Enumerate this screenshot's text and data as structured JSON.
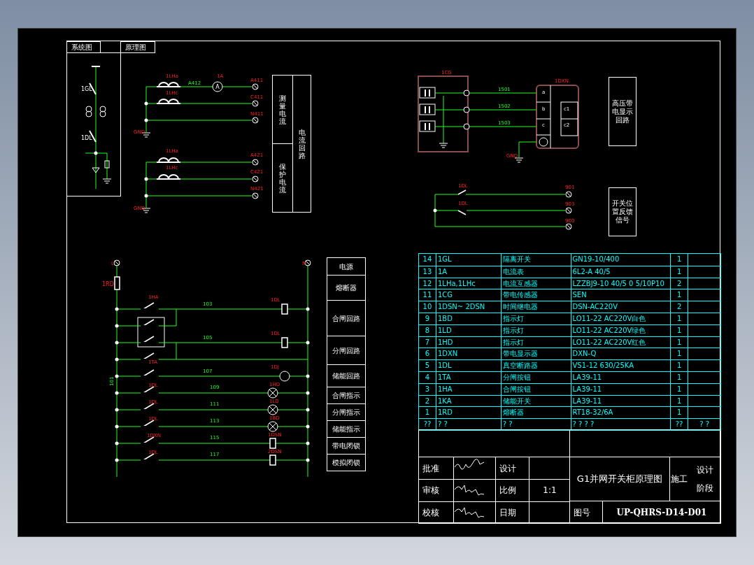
{
  "view_tabs": [
    {
      "label": "系统图"
    },
    {
      "label": "原理图"
    }
  ],
  "system_diagram": {
    "labels": [
      "1GL",
      "1DL"
    ]
  },
  "current_circuit": {
    "labels": [
      {
        "text": "1LHa",
        "kind": "device"
      },
      {
        "text": "A412",
        "kind": "wire"
      },
      {
        "text": "1A",
        "kind": "device"
      },
      {
        "text": "A",
        "kind": "plain"
      },
      {
        "text": "A411",
        "kind": "device"
      },
      {
        "text": "1LHc",
        "kind": "device"
      },
      {
        "text": "C411",
        "kind": "device"
      },
      {
        "text": "N411",
        "kind": "device"
      },
      {
        "text": "GND",
        "kind": "device"
      },
      {
        "text": "1LHa",
        "kind": "device"
      },
      {
        "text": "A421",
        "kind": "device"
      },
      {
        "text": "1LHc",
        "kind": "device"
      },
      {
        "text": "C421",
        "kind": "device"
      },
      {
        "text": "N421",
        "kind": "device"
      },
      {
        "text": "GND",
        "kind": "device"
      }
    ]
  },
  "current_groups": {
    "left": [
      "测量电流",
      "保护电流"
    ],
    "right": "电流回路"
  },
  "sensor_circuit": {
    "labels": [
      {
        "text": "1CG",
        "kind": "device"
      },
      {
        "text": "1DXN",
        "kind": "device"
      },
      {
        "text": "1501",
        "kind": "wire"
      },
      {
        "text": "1502",
        "kind": "wire"
      },
      {
        "text": "1503",
        "kind": "wire"
      },
      {
        "text": "GND",
        "kind": "device"
      },
      {
        "text": "a",
        "kind": "plain"
      },
      {
        "text": "b",
        "kind": "plain"
      },
      {
        "text": "c",
        "kind": "plain"
      },
      {
        "text": "c1",
        "kind": "plain"
      },
      {
        "text": "c2",
        "kind": "plain"
      }
    ]
  },
  "display_box": "高压带电显示回路",
  "feedback_circuit": {
    "labels": [
      {
        "text": "1DL",
        "kind": "device"
      },
      {
        "text": "1DL",
        "kind": "device"
      },
      {
        "text": "901",
        "kind": "device"
      },
      {
        "text": "903",
        "kind": "device"
      },
      {
        "text": "900",
        "kind": "device"
      }
    ]
  },
  "feedback_box": "开关位置反馈信号",
  "control_circuit": {
    "labels": [
      {
        "text": "L",
        "kind": "device"
      },
      {
        "text": "N",
        "kind": "device"
      },
      {
        "text": "1RD",
        "kind": "device"
      },
      {
        "text": "1HA",
        "kind": "device"
      },
      {
        "text": "103",
        "kind": "wire"
      },
      {
        "text": "1DL",
        "kind": "device"
      },
      {
        "text": "105",
        "kind": "wire"
      },
      {
        "text": "1DL",
        "kind": "device"
      },
      {
        "text": "1TA",
        "kind": "device"
      },
      {
        "text": "107",
        "kind": "wire"
      },
      {
        "text": "1DJ",
        "kind": "device"
      },
      {
        "text": "101",
        "kind": "wire"
      },
      {
        "text": "1DL",
        "kind": "device"
      },
      {
        "text": "109",
        "kind": "wire"
      },
      {
        "text": "1HD",
        "kind": "device"
      },
      {
        "text": "1DL",
        "kind": "device"
      },
      {
        "text": "111",
        "kind": "wire"
      },
      {
        "text": "1LD",
        "kind": "device"
      },
      {
        "text": "1DL",
        "kind": "device"
      },
      {
        "text": "113",
        "kind": "wire"
      },
      {
        "text": "1BD",
        "kind": "device"
      },
      {
        "text": "1DXN",
        "kind": "device"
      },
      {
        "text": "115",
        "kind": "wire"
      },
      {
        "text": "1DSN",
        "kind": "device"
      },
      {
        "text": "1DL",
        "kind": "device"
      },
      {
        "text": "117",
        "kind": "wire"
      },
      {
        "text": "2DSN",
        "kind": "device"
      }
    ]
  },
  "control_functions": [
    "电源",
    "熔断器",
    "合闸回路",
    "分闸回路",
    "储能回路",
    "合闸指示",
    "分闸指示",
    "储能指示",
    "带电闭锁",
    "模拟闭锁"
  ],
  "parts_table": {
    "rows": [
      [
        "14",
        "1GL",
        "隔离开关",
        "GN19-10/400",
        "1"
      ],
      [
        "13",
        "1A",
        "电流表",
        "6L2-A 40/5",
        "1"
      ],
      [
        "12",
        "1LHa,1LHc",
        "电流互感器",
        "LZZBJ9-10 40/5 0 5/10P10",
        "2"
      ],
      [
        "11",
        "1CG",
        "带电传感器",
        "SEN",
        "1"
      ],
      [
        "10",
        "1DSN~ 2DSN",
        "时间继电器",
        "DSN-AC220V",
        "2"
      ],
      [
        "9",
        "1BD",
        "指示灯",
        "LO11-22 AC220V白色",
        "1"
      ],
      [
        "8",
        "1LD",
        "指示灯",
        "LO11-22 AC220V绿色",
        "1"
      ],
      [
        "7",
        "1HD",
        "指示灯",
        "LO11-22 AC220V红色",
        "1"
      ],
      [
        "6",
        "1DXN",
        "带电显示器",
        "DXN-Q",
        "1"
      ],
      [
        "5",
        "1DL",
        "真空断路器",
        "VS1-12 630/25KA",
        "1"
      ],
      [
        "4",
        "1TA",
        "分闸按钮",
        "LA39-11",
        "1"
      ],
      [
        "3",
        "1HA",
        "合闸按钮",
        "LA39-11",
        "1"
      ],
      [
        "2",
        "1KA",
        "储能开关",
        "LA39-11",
        "1"
      ],
      [
        "1",
        "1RD",
        "熔断器",
        "RT18-32/6A",
        "1"
      ]
    ],
    "footer": [
      "??",
      "? ?",
      "? ?",
      "? ? ? ?",
      "??",
      "? ?"
    ]
  },
  "title_block": {
    "approve": "批准",
    "review": "审核",
    "check": "校核",
    "design": "设计",
    "scale_label": "比例",
    "scale": "1:1",
    "date_label": "日期",
    "title": "G1并网开关柜原理图",
    "stage_value": "施工",
    "stage_label": [
      "设计",
      "阶段"
    ],
    "number_label": "图号",
    "number": "UP-QHRS-D14-D01"
  }
}
